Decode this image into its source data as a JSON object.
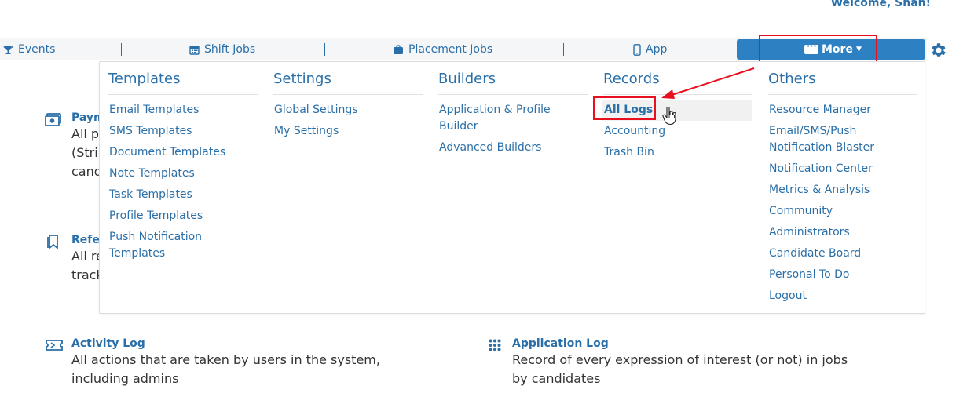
{
  "header": {
    "welcome": "Welcome, Shah!"
  },
  "nav": {
    "events": "Events",
    "shift_jobs": "Shift Jobs",
    "placement_jobs": "Placement Jobs",
    "app": "App",
    "more": "More"
  },
  "colors": {
    "brand": "#2a6fa8",
    "button": "#2d80c2",
    "highlight": "#e8101e"
  },
  "menu": {
    "templates": {
      "heading": "Templates",
      "items": [
        "Email Templates",
        "SMS Templates",
        "Document Templates",
        "Note Templates",
        "Task Templates",
        "Profile Templates",
        "Push Notification",
        "Templates"
      ]
    },
    "settings": {
      "heading": "Settings",
      "items": [
        "Global Settings",
        "My Settings"
      ]
    },
    "builders": {
      "heading": "Builders",
      "items": [
        "Application & Profile",
        "Builder",
        "Advanced Builders"
      ]
    },
    "records": {
      "heading": "Records",
      "items": [
        "All Logs",
        "Accounting",
        "Trash Bin"
      ]
    },
    "others": {
      "heading": "Others",
      "items": [
        "Resource Manager",
        "Email/SMS/Push",
        "Notification Blaster",
        "Notification Center",
        "Metrics & Analysis",
        "Community",
        "Administrators",
        "Candidate Board",
        "Personal To Do",
        "Logout"
      ]
    }
  },
  "content": {
    "payments": {
      "title": "Paym",
      "desc1": "All p",
      "desc2": "(Strip",
      "desc3": "cand"
    },
    "referrals": {
      "title": "Refe",
      "desc1": "All re",
      "desc2": "track"
    },
    "activity_log": {
      "title": "Activity Log",
      "desc1": "All actions that are taken by users in the system,",
      "desc2": "including admins"
    },
    "application_log": {
      "title": "Application Log",
      "desc1": "Record of every expression of interest (or not) in jobs",
      "desc2": "by candidates"
    }
  }
}
